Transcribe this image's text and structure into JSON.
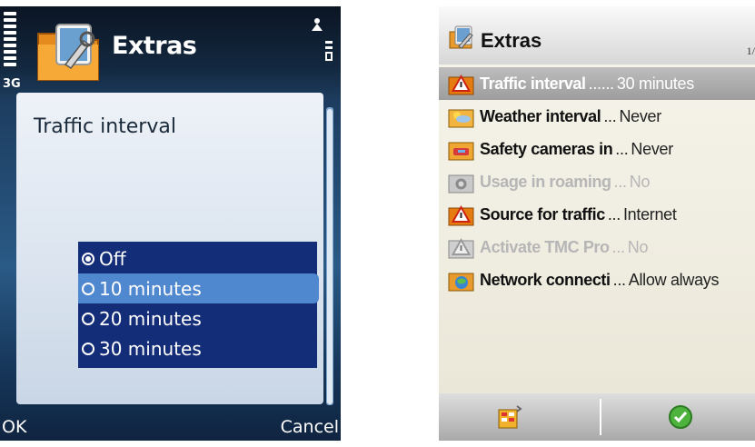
{
  "left": {
    "status": {
      "network": "3G"
    },
    "header": {
      "title": "Extras"
    },
    "panel": {
      "title": "Traffic interval"
    },
    "options": [
      {
        "label": "Off",
        "selected": true,
        "highlighted": false
      },
      {
        "label": "10 minutes",
        "selected": false,
        "highlighted": true
      },
      {
        "label": "20 minutes",
        "selected": false,
        "highlighted": false
      },
      {
        "label": "30 minutes",
        "selected": false,
        "highlighted": false
      }
    ],
    "softkeys": {
      "left": "OK",
      "right": "Cancel"
    }
  },
  "right": {
    "header": {
      "title": "Extras",
      "page": "1/"
    },
    "items": [
      {
        "label": "Traffic interval",
        "dots": " ......",
        "value": "30 minutes",
        "icon": "traffic-warning-icon",
        "disabled": false,
        "selected": true
      },
      {
        "label": "Weather interval",
        "dots": " ...",
        "value": "Never",
        "icon": "weather-icon",
        "disabled": false,
        "selected": false
      },
      {
        "label": "Safety cameras in",
        "dots": "...",
        "value": "Never",
        "icon": "safety-camera-icon",
        "disabled": false,
        "selected": false
      },
      {
        "label": "Usage in roaming",
        "dots": "...",
        "value": "No",
        "icon": "roaming-icon",
        "disabled": true,
        "selected": false
      },
      {
        "label": "Source for traffic",
        "dots": " ...",
        "value": "Internet",
        "icon": "traffic-source-icon",
        "disabled": false,
        "selected": false
      },
      {
        "label": "Activate TMC Pro",
        "dots": "...",
        "value": "No",
        "icon": "tmc-icon",
        "disabled": true,
        "selected": false
      },
      {
        "label": "Network connecti",
        "dots": "...",
        "value": "Allow always",
        "icon": "network-icon",
        "disabled": false,
        "selected": false
      }
    ],
    "footer": {
      "left_icon": "options-icon",
      "right_icon": "ok-check-icon"
    }
  }
}
